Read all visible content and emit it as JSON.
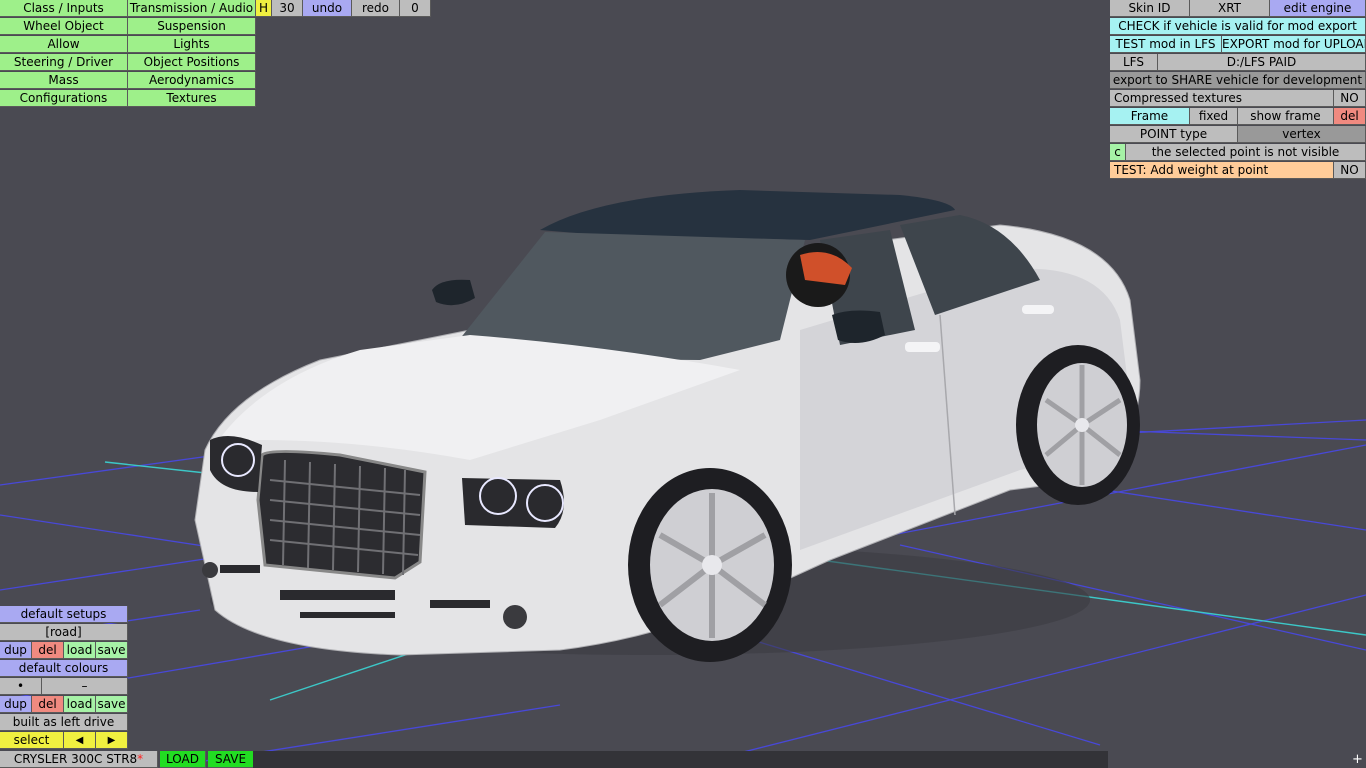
{
  "top_menu": {
    "class_inputs": "Class / Inputs",
    "transmission_audio": "Transmission / Audio",
    "h_label": "H",
    "counter_value": "30",
    "undo": "undo",
    "redo": "redo",
    "redo_count": "0",
    "wheel_object": "Wheel Object",
    "suspension": "Suspension",
    "allow": "Allow",
    "lights": "Lights",
    "steering_driver": "Steering / Driver",
    "object_positions": "Object Positions",
    "mass": "Mass",
    "aerodynamics": "Aerodynamics",
    "configurations": "Configurations",
    "textures": "Textures"
  },
  "right_panel": {
    "skin_id": "Skin ID",
    "xrt": "XRT",
    "edit_engine": "edit engine",
    "check_valid": "CHECK if vehicle is valid for mod export",
    "test_mod": "TEST mod in LFS",
    "export_upload": "EXPORT mod for UPLOAD",
    "lfs": "LFS",
    "lfs_path": "D:/LFS PAID",
    "export_share": "export to SHARE vehicle for development",
    "compressed_textures": "Compressed textures",
    "compressed_value": "NO",
    "frame": "Frame",
    "fixed": "fixed",
    "show_frame": "show frame",
    "del": "del",
    "point_type": "POINT type",
    "point_type_value": "vertex",
    "c_label": "c",
    "point_status": "the selected point is not visible",
    "test_weight": "TEST: Add weight at point",
    "test_weight_value": "NO"
  },
  "left_panel": {
    "default_setups": "default setups",
    "setup_name": "[road]",
    "dup": "dup",
    "del": "del",
    "load": "load",
    "save": "save",
    "default_colours": "default colours",
    "colour_dot": "•",
    "colour_dash": "–",
    "built_as": "built as left drive",
    "select": "select",
    "prev_arrow": "◀",
    "next_arrow": "▶"
  },
  "bottom_bar": {
    "vehicle_name": "CRYSLER 300C STR8",
    "modified_marker": "*",
    "load": "LOAD",
    "save": "SAVE",
    "plus": "+"
  },
  "colors": {
    "background": "#4a4a52",
    "grid_blue": "#4a4ae0",
    "grid_cyan": "#40d0d0",
    "car_body": "#e4e4e6",
    "car_roof": "#26323f"
  }
}
